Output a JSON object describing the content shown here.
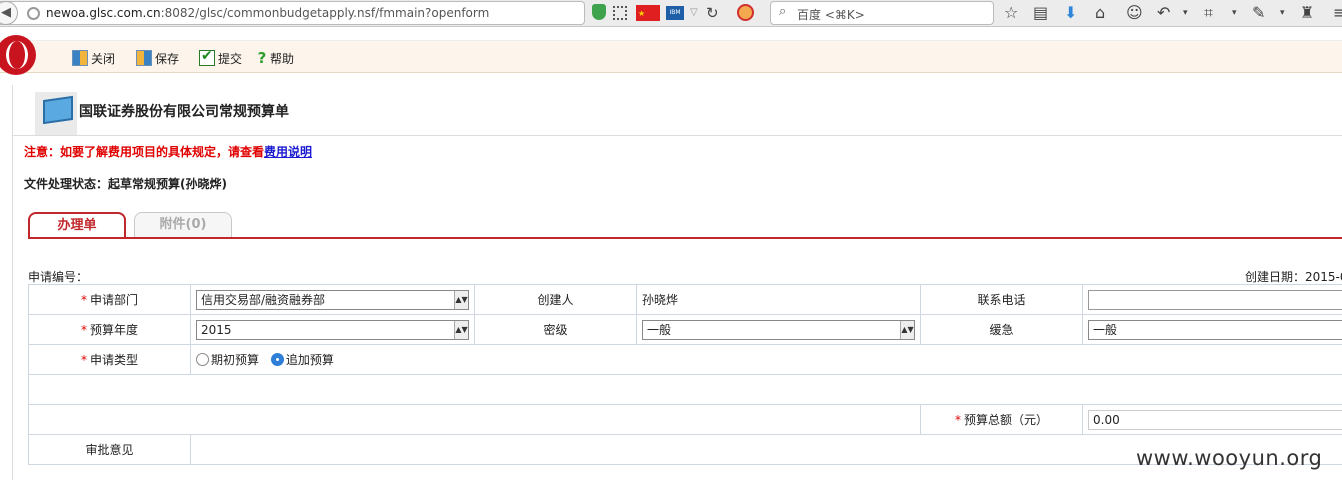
{
  "browser": {
    "url_host": "newoa.glsc.com.cn",
    "url_rest": ":8082/glsc/commonbudgetapply.nsf/fmmain?openform",
    "search_placeholder": "百度 <⌘K>",
    "ibm_label": "IBM"
  },
  "toolbar": {
    "close_label": "关闭",
    "save_label": "保存",
    "submit_label": "提交",
    "help_label": "帮助"
  },
  "header": {
    "title": "国联证券股份有限公司常规预算单"
  },
  "notice": {
    "text": "注意：如要了解费用项目的具体规定，请查看",
    "link": "费用说明"
  },
  "status": {
    "text": "文件处理状态：起草常规预算(孙晓烨)"
  },
  "tabs": [
    {
      "label": "办理单"
    },
    {
      "label": "附件(0)"
    }
  ],
  "form": {
    "apply_no_label": "申请编号：",
    "create_date_label": "创建日期：2015-0",
    "required_mark": "*",
    "department_label": "申请部门",
    "department_value": "信用交易部/融资融券部",
    "creator_label": "创建人",
    "creator_value": "孙晓烨",
    "phone_label": "联系电话",
    "phone_value": "",
    "year_label": "预算年度",
    "year_value": "2015",
    "secret_label": "密级",
    "secret_value": "一般",
    "urgency_label": "缓急",
    "urgency_value": "一般",
    "type_label": "申请类型",
    "type_options": [
      "期初预算",
      "追加预算"
    ],
    "type_selected": "追加预算",
    "total_label": "预算总额（元）",
    "total_value": "0.00",
    "approval_label": "审批意见"
  },
  "watermark": "www.wooyun.org"
}
